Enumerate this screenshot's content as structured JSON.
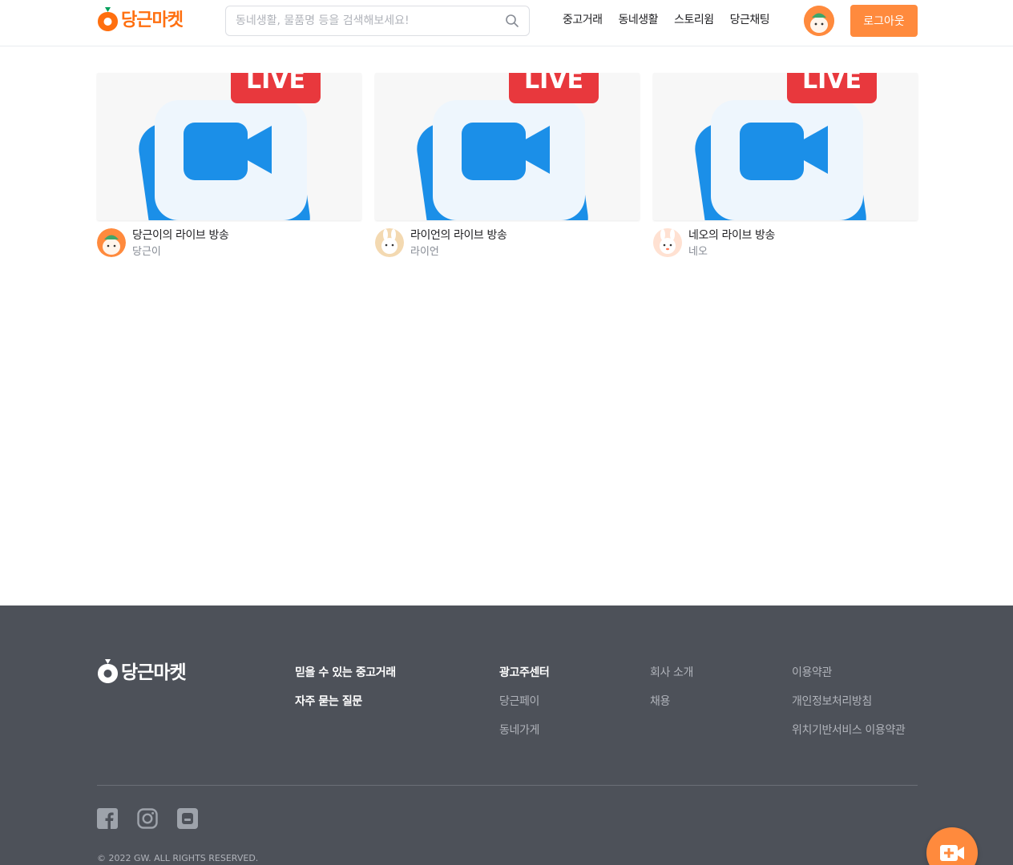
{
  "header": {
    "logo_text": "당근마켓",
    "search_placeholder": "동네생활, 물품명 등을 검색해보세요!",
    "nav": [
      "중고거래",
      "동네생활",
      "스토리윔",
      "당근채팅"
    ],
    "logout_label": "로그아웃",
    "accent_color": "#ff8a3d",
    "brand_color": "#ff6f0f"
  },
  "cards": [
    {
      "thumb_badge": "LIVE",
      "title": "당근이의 라이브 방송",
      "author": "당근이",
      "avatar_icon": "carrot-character-icon"
    },
    {
      "thumb_badge": "LIVE",
      "title": "라이언의 라이브 방송",
      "author": "라이언",
      "avatar_icon": "rabbit-character-icon"
    },
    {
      "thumb_badge": "LIVE",
      "title": "네오의 라이브 방송",
      "author": "네오",
      "avatar_icon": "bunny-character-icon"
    }
  ],
  "footer": {
    "logo_text": "당근마켓",
    "col1": [
      "믿을 수 있는 중고거래",
      "자주 묻는 질문"
    ],
    "col2": [
      "광고주센터",
      "당근페이",
      "동네가게"
    ],
    "col3": [
      "회사 소개",
      "채용"
    ],
    "col4": [
      "이용약관",
      "개인정보처리방침",
      "위치기반서비스 이용약관"
    ],
    "social": [
      "facebook-icon",
      "instagram-icon",
      "blog-icon"
    ],
    "copyright": "© 2022 GW. ALL RIGHTS RESERVED."
  },
  "fab_icon": "video-add-icon"
}
